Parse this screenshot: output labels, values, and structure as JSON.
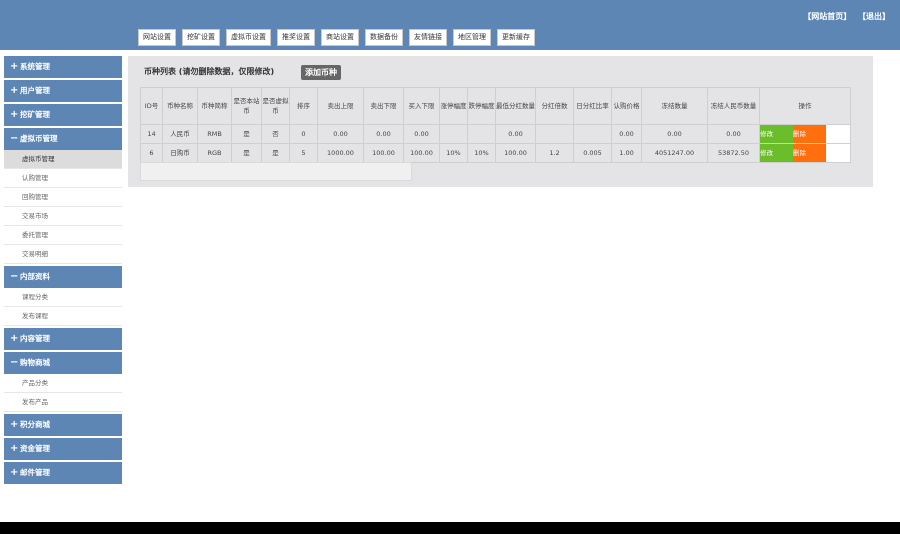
{
  "header": {
    "links": [
      "【网站首页】",
      "【退出】"
    ],
    "nav": [
      "网站设置",
      "挖矿设置",
      "虚拟币设置",
      "推奖设置",
      "商站设置",
      "数据备份",
      "友情链接",
      "地区管理",
      "更新缓存"
    ]
  },
  "sidebar": {
    "groups": [
      {
        "label": "系统管理",
        "icon": "plus-icon",
        "expanded": false,
        "items": []
      },
      {
        "label": "用户管理",
        "icon": "plus-icon",
        "expanded": false,
        "items": []
      },
      {
        "label": "挖矿管理",
        "icon": "plus-icon",
        "expanded": false,
        "items": []
      },
      {
        "label": "虚拟币管理",
        "icon": "minus-icon",
        "expanded": true,
        "items": [
          "虚拟币管理",
          "认购管理",
          "回购管理",
          "交易市场",
          "委托管理",
          "交易明细"
        ]
      },
      {
        "label": "内部资料",
        "icon": "minus-icon",
        "expanded": true,
        "items": [
          "课程分类",
          "发布课程"
        ]
      },
      {
        "label": "内容管理",
        "icon": "plus-icon",
        "expanded": false,
        "items": []
      },
      {
        "label": "购物商城",
        "icon": "minus-icon",
        "expanded": true,
        "items": [
          "产品分类",
          "发布产品"
        ]
      },
      {
        "label": "积分商城",
        "icon": "plus-icon",
        "expanded": false,
        "items": []
      },
      {
        "label": "资金管理",
        "icon": "plus-icon",
        "expanded": false,
        "items": []
      },
      {
        "label": "邮件管理",
        "icon": "plus-icon",
        "expanded": false,
        "items": []
      }
    ],
    "active_item": "虚拟币管理"
  },
  "main": {
    "title": "币种列表 (请勿删除数据，仅限修改)",
    "add_button": "添加币种",
    "columns": [
      "ID号",
      "币种名称",
      "币种简称",
      "是否本站币",
      "是否虚拟币",
      "排序",
      "卖出上限",
      "卖出下限",
      "买入下限",
      "涨停幅度",
      "跌停幅度",
      "最低分红数量",
      "分红倍数",
      "日分红比率",
      "认购价格",
      "冻结数量",
      "冻结人民币数量",
      "操作"
    ],
    "rows": [
      [
        "14",
        "人民币",
        "RMB",
        "是",
        "否",
        "0",
        "0.00",
        "0.00",
        "0.00",
        "",
        "",
        "0.00",
        "",
        "",
        "0.00",
        "0.00",
        "0.00"
      ],
      [
        "6",
        "日购币",
        "RGB",
        "是",
        "是",
        "5",
        "1000.00",
        "100.00",
        "100.00",
        "10%",
        "10%",
        "100.00",
        "1.2",
        "0.005",
        "1.00",
        "4051247.00",
        "53872.50"
      ]
    ],
    "edit_label": "修改",
    "delete_label": "删除"
  },
  "colors": {
    "header": "#5d86b4",
    "edit": "#6cbd2b",
    "delete": "#ff6f0e"
  }
}
